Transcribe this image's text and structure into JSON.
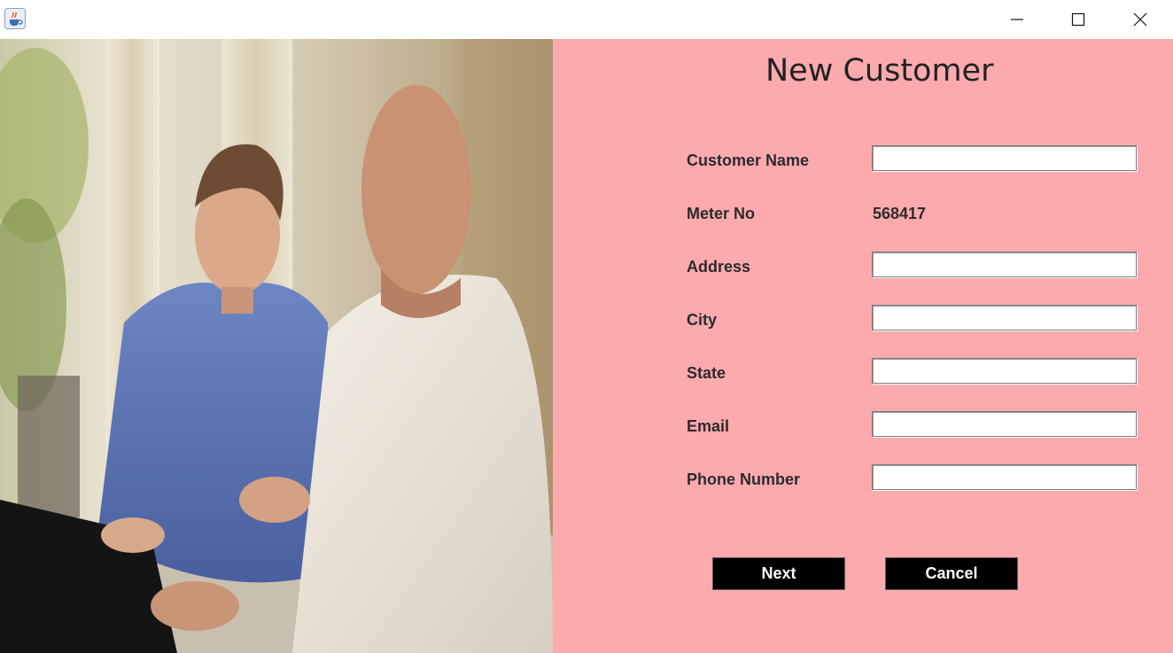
{
  "window": {
    "icon": "java-cup-icon",
    "controls": {
      "minimize": "minimize-icon",
      "maximize": "maximize-icon",
      "close": "close-icon"
    }
  },
  "colors": {
    "form_background": "#fdaaae",
    "button_background": "#000000",
    "button_text": "#ffffff",
    "label_text": "#2b2b2b"
  },
  "form": {
    "title": "New Customer",
    "fields": [
      {
        "label": "Customer Name",
        "value": "",
        "type": "input"
      },
      {
        "label": "Meter No",
        "value": "568417",
        "type": "static"
      },
      {
        "label": "Address",
        "value": "",
        "type": "input"
      },
      {
        "label": "City",
        "value": "",
        "type": "input"
      },
      {
        "label": "State",
        "value": "",
        "type": "input"
      },
      {
        "label": "Email",
        "value": "",
        "type": "input"
      },
      {
        "label": "Phone Number",
        "value": "",
        "type": "input"
      }
    ],
    "buttons": {
      "next": "Next",
      "cancel": "Cancel"
    }
  }
}
